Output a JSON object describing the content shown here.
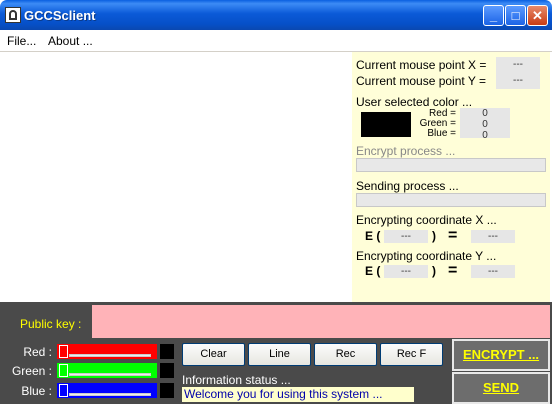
{
  "window": {
    "title": "GCCSclient",
    "minimize_glyph": "_",
    "maximize_glyph": "□",
    "close_glyph": "✕"
  },
  "menu": {
    "file": "File...",
    "about": "About ..."
  },
  "info": {
    "mouse_x_label": "Current mouse point X =",
    "mouse_x_value": "---",
    "mouse_y_label": "Current mouse point Y =",
    "mouse_y_value": "---",
    "color_label": "User selected color ...",
    "red_label": "Red =",
    "red_value": "0",
    "green_label": "Green =",
    "green_value": "0",
    "blue_label": "Blue =",
    "blue_value": "0",
    "encrypt_process_label": "Encrypt process ...",
    "sending_process_label": "Sending process ...",
    "enc_x_label": "Encrypting coordinate X ...",
    "enc_y_label": "Encrypting coordinate Y ...",
    "e_open": "E (",
    "e_close": ")",
    "equals": "=",
    "placeholder": "---",
    "selected_color": "#000000"
  },
  "bottom": {
    "public_key_label": "Public key :",
    "public_key_value": "",
    "red_label": "Red :",
    "green_label": "Green :",
    "blue_label": "Blue :",
    "red_color": "#ff0000",
    "green_color": "#00ff00",
    "blue_color": "#0000ff",
    "buttons": {
      "clear": "Clear",
      "line": "Line",
      "rec": "Rec",
      "rec_f": "Rec F"
    },
    "status_label": "Information status ...",
    "status_text": "Welcome you for using this system ...",
    "encrypt_btn": "ENCRYPT ...",
    "send_btn": "SEND"
  }
}
